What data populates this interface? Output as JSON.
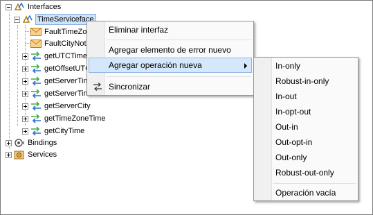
{
  "tree": {
    "interfaces_label": "Interfaces",
    "service_label": "TimeServiceface",
    "children": [
      "FaultTimeZone",
      "FaultCityNotF",
      "getUTCTime",
      "getOffsetUTC",
      "getServerTim",
      "getServerTim",
      "getServerCity",
      "getTimeZoneTime",
      "getCityTime"
    ],
    "bindings_label": "Bindings",
    "services_label": "Services"
  },
  "context_menu": {
    "items": [
      "Eliminar interfaz",
      "Agregar elemento de error nuevo",
      "Agregar operación nueva",
      "Sincronizar"
    ]
  },
  "submenu": {
    "items": [
      "In-only",
      "Robust-in-only",
      "In-out",
      "In-opt-out",
      "Out-in",
      "Out-opt-in",
      "Out-only",
      "Robust-out-only",
      "Operación vacía"
    ]
  },
  "colors": {
    "selection": "#cfe3fa",
    "menu_highlight": "#d5e7fb",
    "operation_arrow_green": "#3fae3a",
    "operation_arrow_blue": "#2f6fd0",
    "fault_envelope": "#e8a436"
  }
}
